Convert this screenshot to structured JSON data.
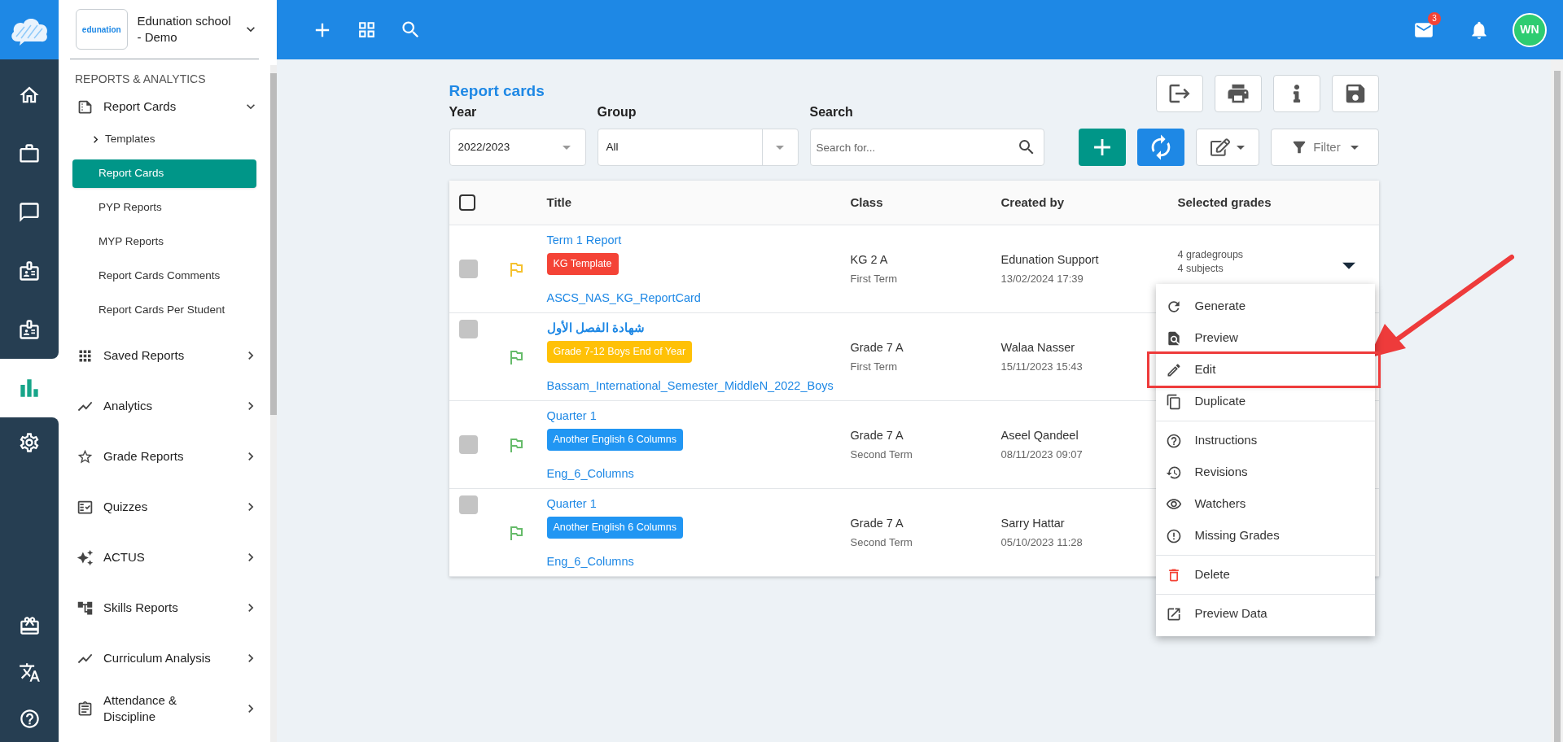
{
  "app": {
    "logo_text": "edunation",
    "school_name": "Edunation school - Demo"
  },
  "sidebar": {
    "section_title": "REPORTS & ANALYTICS",
    "items": [
      {
        "label": "Report Cards",
        "expanded": true,
        "children": [
          {
            "label": "Templates",
            "kind": "group",
            "selected": false
          },
          {
            "label": "Report Cards",
            "kind": "link",
            "selected": true
          },
          {
            "label": "PYP Reports",
            "kind": "link",
            "selected": false
          },
          {
            "label": "MYP Reports",
            "kind": "link",
            "selected": false
          },
          {
            "label": "Report Cards Comments",
            "kind": "link",
            "selected": false
          },
          {
            "label": "Report Cards Per Student",
            "kind": "link",
            "selected": false
          }
        ]
      },
      {
        "label": "Saved Reports",
        "expanded": false
      },
      {
        "label": "Analytics",
        "expanded": false
      },
      {
        "label": "Grade Reports",
        "expanded": false
      },
      {
        "label": "Quizzes",
        "expanded": false
      },
      {
        "label": "ACTUS",
        "expanded": false
      },
      {
        "label": "Skills Reports",
        "expanded": false
      },
      {
        "label": "Curriculum Analysis",
        "expanded": false
      },
      {
        "label": "Attendance & Discipline",
        "expanded": false
      }
    ]
  },
  "topbar": {
    "mail_badge": "3",
    "avatar": "WN"
  },
  "page": {
    "title": "Report cards",
    "year": {
      "label": "Year",
      "value": "2022/2023"
    },
    "group": {
      "label": "Group",
      "value": "All"
    },
    "search": {
      "label": "Search",
      "placeholder": "Search for..."
    },
    "filter_button": "Filter"
  },
  "table": {
    "header_checked": false,
    "columns": [
      "Title",
      "Class",
      "Created by",
      "Selected grades"
    ],
    "rows": [
      {
        "checked": false,
        "color": "#f5c12e",
        "title": "Term 1 Report",
        "tag": {
          "label": "KG Template",
          "color": "#f44336"
        },
        "template": "ASCS_NAS_KG_ReportCard",
        "class": "KG 2 A",
        "term": "First Term",
        "created_by": "Edunation Support",
        "created_at": "13/02/2024 17:39",
        "selected_grades": [
          "4 gradegroups",
          "4 subjects"
        ]
      },
      {
        "checked": false,
        "color": "#66bb6a",
        "title": "شهادة الفصل الأول",
        "tag": {
          "label": "Grade 7-12 Boys End of Year",
          "color": "#ffc107"
        },
        "template": "Bassam_International_Semester_MiddleN_2022_Boys",
        "class": "Grade 7 A",
        "term": "First Term",
        "created_by": "Walaa Nasser",
        "created_at": "15/11/2023 15:43",
        "selected_grades": []
      },
      {
        "checked": false,
        "color": "#66bb6a",
        "title": "Quarter 1",
        "tag": {
          "label": "Another English 6 Columns",
          "color": "#2196f3"
        },
        "template": "Eng_6_Columns",
        "class": "Grade 7 A",
        "term": "Second Term",
        "created_by": "Aseel Qandeel",
        "created_at": "08/11/2023 09:07",
        "selected_grades": []
      },
      {
        "checked": false,
        "color": "#66bb6a",
        "title": "Quarter 1",
        "tag": {
          "label": "Another English 6 Columns",
          "color": "#2196f3"
        },
        "template": "Eng_6_Columns",
        "class": "Grade 7 A",
        "term": "Second Term",
        "created_by": "Sarry Hattar",
        "created_at": "05/10/2023 11:28",
        "selected_grades": []
      }
    ]
  },
  "context_menu": {
    "sections": [
      [
        {
          "label": "Generate",
          "kind": "generate",
          "highlighted": false
        },
        {
          "label": "Preview",
          "kind": "preview",
          "highlighted": false
        },
        {
          "label": "Edit",
          "kind": "edit",
          "highlighted": true
        },
        {
          "label": "Duplicate",
          "kind": "duplicate",
          "highlighted": false
        }
      ],
      [
        {
          "label": "Instructions",
          "kind": "instructions",
          "highlighted": false
        },
        {
          "label": "Revisions",
          "kind": "revisions",
          "highlighted": false
        },
        {
          "label": "Watchers",
          "kind": "watchers",
          "highlighted": false
        },
        {
          "label": "Missing Grades",
          "kind": "missing",
          "highlighted": false
        }
      ],
      [
        {
          "label": "Delete",
          "kind": "delete",
          "highlighted": false
        }
      ],
      [
        {
          "label": "Preview Data",
          "kind": "preview_data",
          "highlighted": false
        }
      ]
    ]
  }
}
